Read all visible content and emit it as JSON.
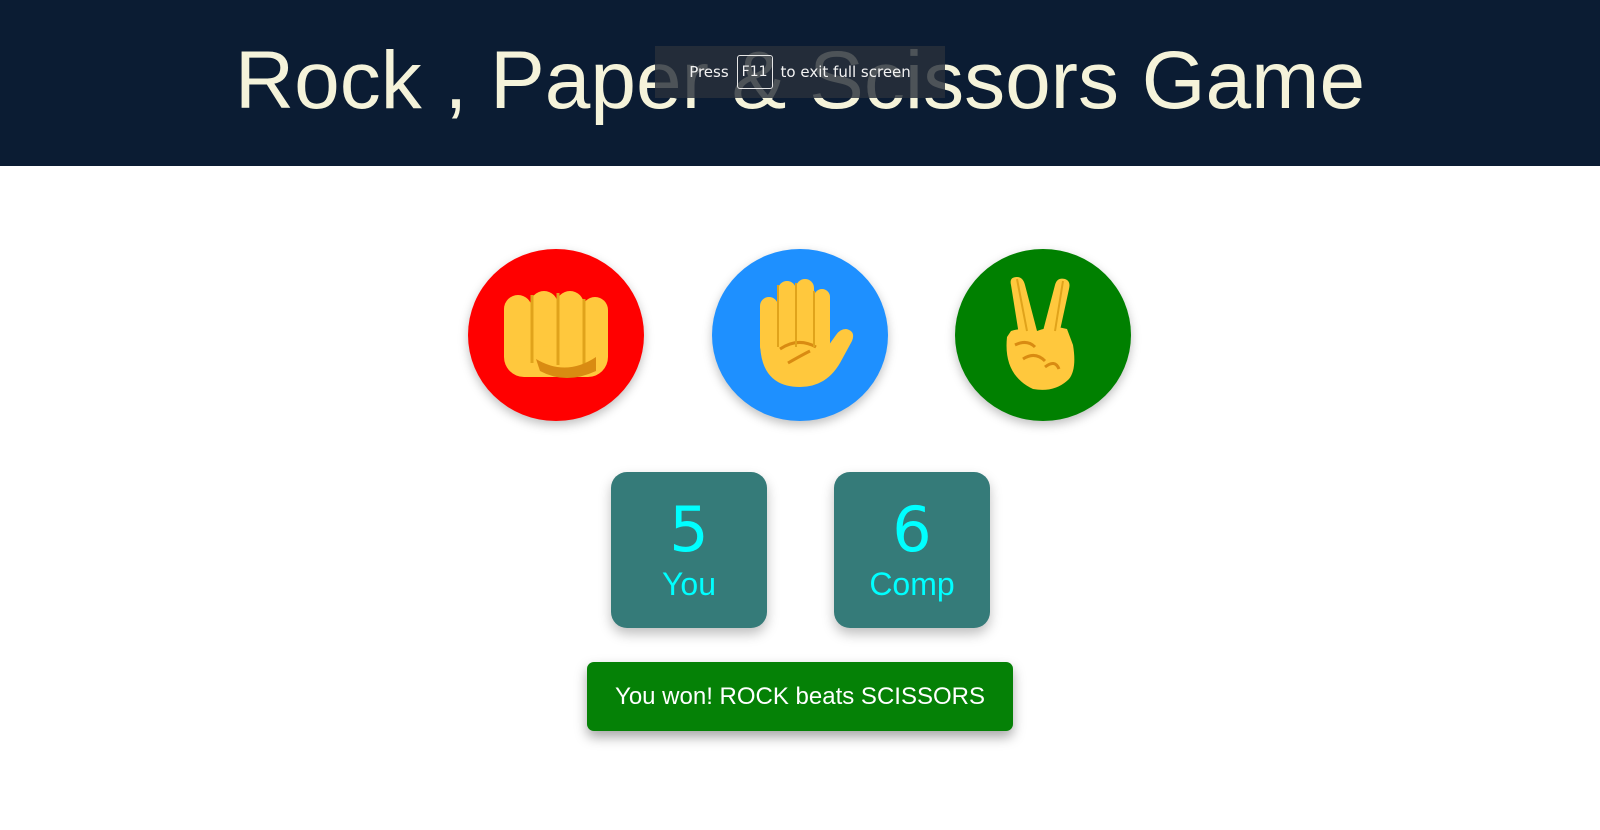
{
  "header": {
    "title": "Rock , Paper & Scissors Game"
  },
  "fullscreen_notice": {
    "prefix": "Press",
    "key": "F11",
    "suffix": "to exit full screen"
  },
  "choices": [
    {
      "name": "rock",
      "icon": "fist-icon",
      "color": "#ff0000"
    },
    {
      "name": "paper",
      "icon": "open-hand-icon",
      "color": "#1e90ff"
    },
    {
      "name": "scissors",
      "icon": "victory-hand-icon",
      "color": "#008000"
    }
  ],
  "scores": {
    "user": {
      "value": "5",
      "label": "You"
    },
    "computer": {
      "value": "6",
      "label": "Comp"
    }
  },
  "message": {
    "text": "You won! ROCK beats SCISSORS",
    "color": "#058106"
  },
  "colors": {
    "header_bg": "#0b1c33",
    "title_text": "#f5f3da",
    "score_bg": "#357b79",
    "score_text": "#00ffff"
  }
}
